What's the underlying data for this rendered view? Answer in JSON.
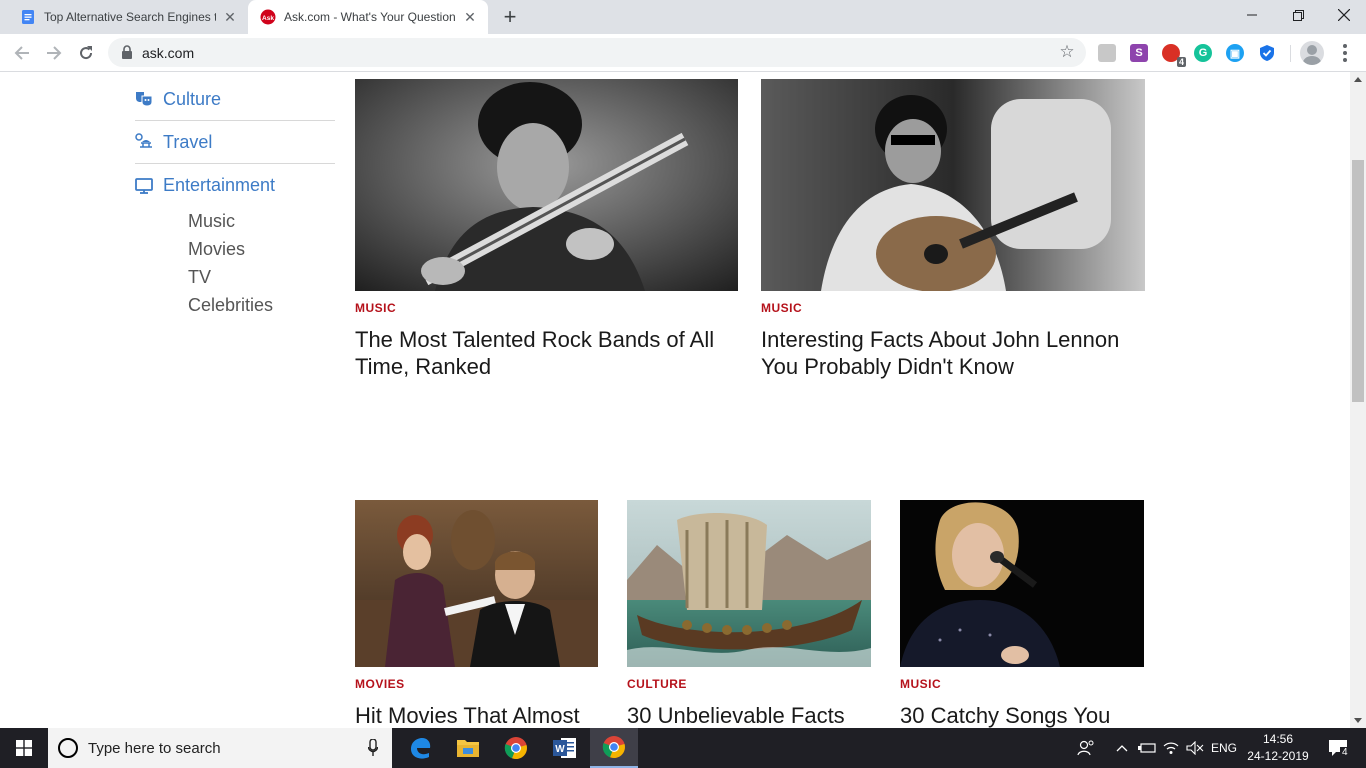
{
  "browser": {
    "tabs": [
      {
        "title": "Top Alternative Search Engines to",
        "icon": "docs-icon"
      },
      {
        "title": "Ask.com - What's Your Question?",
        "icon": "ask-favicon",
        "active": true
      }
    ],
    "url": "ask.com",
    "extension_badge": "4",
    "extension_s_label": "S"
  },
  "sidebar": {
    "categories": [
      {
        "label": "Culture",
        "icon": "culture-masks-icon"
      },
      {
        "label": "Travel",
        "icon": "travel-icon"
      },
      {
        "label": "Entertainment",
        "icon": "monitor-icon"
      }
    ],
    "subcategories": [
      "Music",
      "Movies",
      "TV",
      "Celebrities"
    ]
  },
  "articles": [
    {
      "tag": "MUSIC",
      "title": "The Most Talented Rock Bands of All Time, Ranked",
      "image": "guitarist-bw-photo"
    },
    {
      "tag": "MUSIC",
      "title": "Interesting Facts About John Lennon You Probably Didn't Know",
      "image": "lennon-guitar-bw-photo"
    },
    {
      "tag": "MOVIES",
      "title": "Hit Movies That Almost",
      "image": "titanic-scene-photo"
    },
    {
      "tag": "CULTURE",
      "title": "30 Unbelievable Facts",
      "image": "viking-ship-painting"
    },
    {
      "tag": "MUSIC",
      "title": "30 Catchy Songs You",
      "image": "singer-microphone-photo"
    }
  ],
  "colors": {
    "link_blue": "#3d7bc6",
    "tag_red": "#b5121b",
    "taskbar": "#1f1f25"
  },
  "taskbar": {
    "search_placeholder": "Type here to search",
    "language": "ENG",
    "time": "14:56",
    "date": "24-12-2019",
    "notification_count": "4"
  }
}
